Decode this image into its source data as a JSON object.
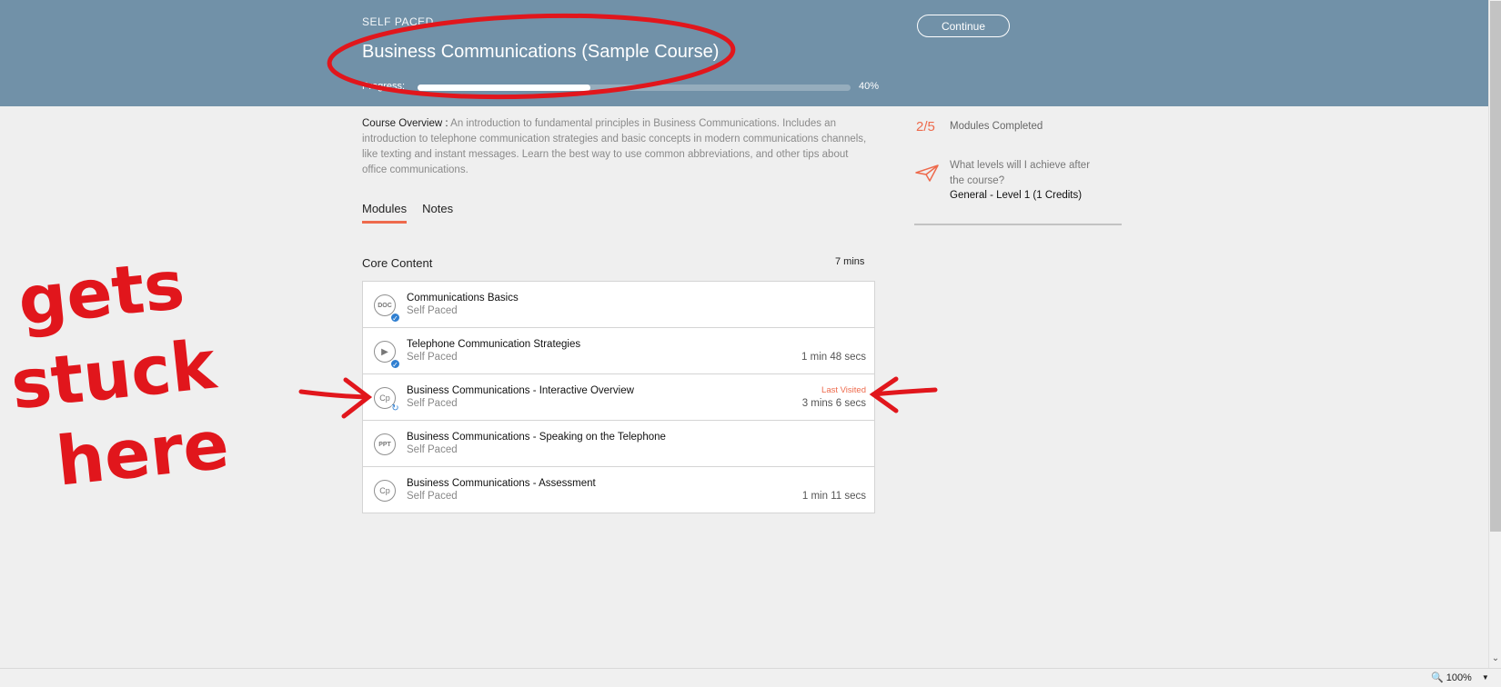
{
  "header": {
    "type_label": "SELF PACED",
    "course_title": "Business Communications (Sample Course)",
    "progress_label": "Progress:",
    "progress_value": 40,
    "progress_text": "40%",
    "continue_label": "Continue"
  },
  "overview": {
    "key": "Course Overview :",
    "text": "An introduction to fundamental principles in Business Communications. Includes an introduction to telephone communication strategies and basic concepts in modern communications channels, like texting and instant messages. Learn the best way to use common abbreviations, and other tips about office communications."
  },
  "tabs": [
    {
      "label": "Modules",
      "active": true
    },
    {
      "label": "Notes",
      "active": false
    }
  ],
  "section": {
    "title": "Core Content",
    "duration": "7 mins"
  },
  "modules": [
    {
      "icon": "doc-icon",
      "icon_text": "DOC",
      "status": "completed",
      "name": "Communications Basics",
      "type": "Self Paced",
      "duration": "",
      "last_visited": ""
    },
    {
      "icon": "play-icon",
      "icon_text": "▶",
      "status": "completed",
      "name": "Telephone Communication Strategies",
      "type": "Self Paced",
      "duration": "1 min 48 secs",
      "last_visited": ""
    },
    {
      "icon": "captivate-icon",
      "icon_text": "Cp",
      "status": "in-progress",
      "name": "Business Communications - Interactive Overview",
      "type": "Self Paced",
      "duration": "3 mins 6 secs",
      "last_visited": "Last Visited"
    },
    {
      "icon": "ppt-icon",
      "icon_text": "PPT",
      "status": "",
      "name": "Business Communications - Speaking on the Telephone",
      "type": "Self Paced",
      "duration": "",
      "last_visited": ""
    },
    {
      "icon": "captivate-icon",
      "icon_text": "Cp",
      "status": "",
      "name": "Business Communications - Assessment",
      "type": "Self Paced",
      "duration": "1 min 11 secs",
      "last_visited": ""
    }
  ],
  "sidebar": {
    "modules_count": "2/5",
    "modules_label": "Modules Completed",
    "levels_question": "What levels will I achieve after the course?",
    "levels_answer": "General - Level 1 (1 Credits)"
  },
  "statusbar": {
    "zoom": "100%"
  },
  "annotation": {
    "handwritten_lines": [
      "gets",
      "stuck",
      "here"
    ]
  },
  "colors": {
    "header_bg": "#7191a8",
    "accent": "#ee6a4c",
    "completed_badge": "#2f7fd1",
    "annotation": "#e1161c"
  }
}
